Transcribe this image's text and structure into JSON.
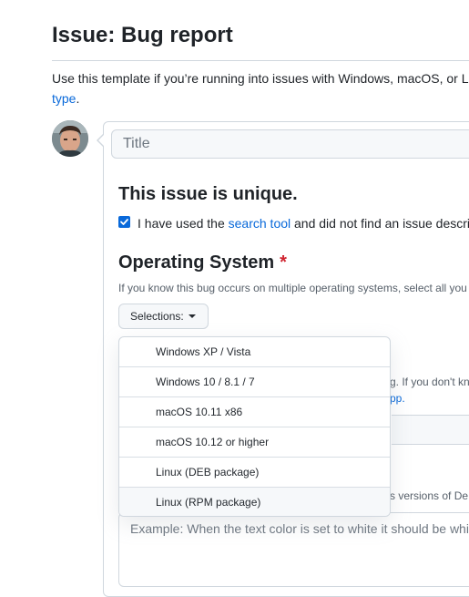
{
  "page": {
    "title": "Issue: Bug report",
    "intro_text": "Use this template if you’re running into issues with Windows, macOS, or Li",
    "intro_link": "type",
    "intro_tail": "."
  },
  "form": {
    "title_placeholder": "Title",
    "unique_heading": "This issue is unique.",
    "checkbox_pre": "I have used the ",
    "checkbox_link": "search tool",
    "checkbox_post": " and did not find an issue descri",
    "checkbox_checked": true,
    "os_heading": "Operating System",
    "required_mark": "*",
    "os_help": "If you know this bug occurs on multiple operating systems, select all you",
    "selections_label": "Selections:",
    "bg_text_1": "g. If you don't kn",
    "bg_link": "pp.",
    "bg_text_2": "s versions of De",
    "textarea_placeholder": "Example: When the text color is set to white it should be whi"
  },
  "dropdown": {
    "options": [
      "Windows XP / Vista",
      "Windows 10 / 8.1 / 7",
      "macOS 10.11 x86",
      "macOS 10.12 or higher",
      "Linux (DEB package)",
      "Linux (RPM package)"
    ],
    "hovered_index": 5
  },
  "colors": {
    "link": "#0969da",
    "required": "#cf222e",
    "border": "#d0d7de"
  }
}
